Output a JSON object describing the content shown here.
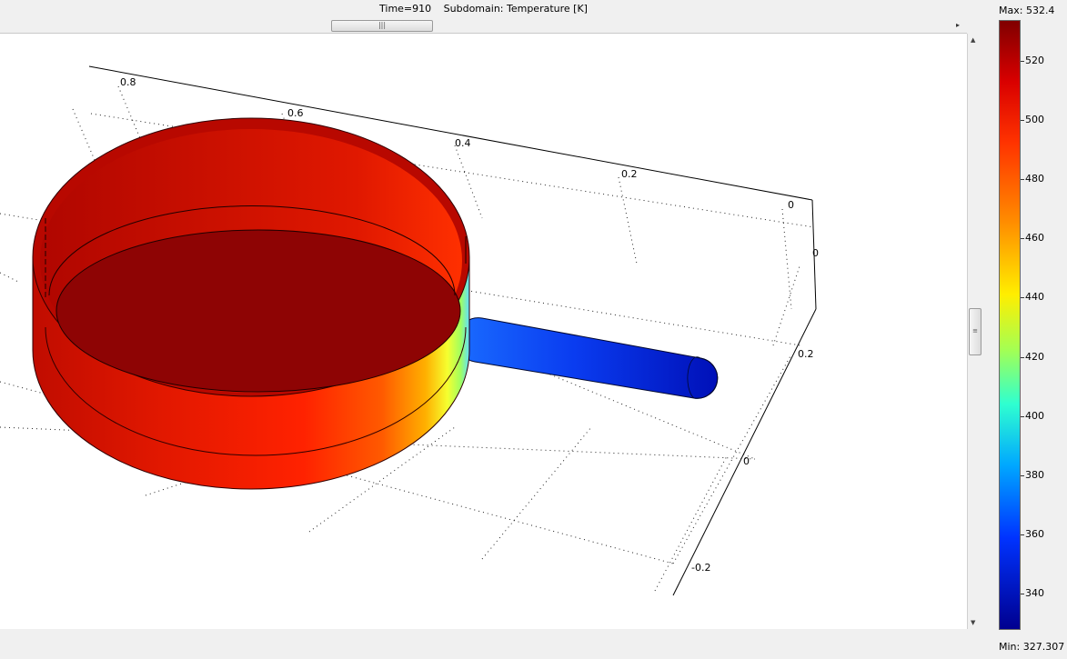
{
  "header": {
    "time_label": "Time=910",
    "subdomain_label": "Subdomain: Temperature [K]"
  },
  "scrollbars": {
    "h_grip": "|||",
    "v_grip": "≡",
    "right_arrow": "▸",
    "up_arrow": "▲",
    "down_arrow": "▼"
  },
  "colorbar": {
    "max_label": "Max: 532.4",
    "min_label": "Min: 327.307",
    "ticks": [
      "520",
      "500",
      "480",
      "460",
      "440",
      "420",
      "400",
      "380",
      "360",
      "340"
    ],
    "colors": {
      "high": "#800000",
      "low": "#00008f"
    }
  },
  "axes": {
    "x_ticks": [
      "0.8",
      "0.6",
      "0.4",
      "0.2",
      "0"
    ],
    "y_ticks": [
      "0",
      "0.2",
      "0",
      "-0.2"
    ]
  },
  "model": {
    "pan_color": "#c81000",
    "handle_color": "#0a30e0"
  }
}
